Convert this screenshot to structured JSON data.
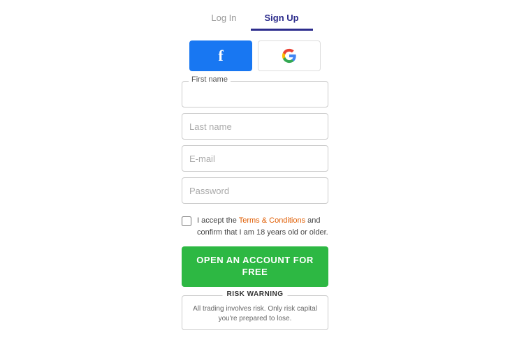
{
  "tabs": {
    "login": {
      "label": "Log In"
    },
    "signup": {
      "label": "Sign Up"
    }
  },
  "social": {
    "facebook_label": "f",
    "google_label": "G"
  },
  "form": {
    "first_name_label": "First name",
    "first_name_placeholder": "",
    "last_name_placeholder": "Last name",
    "email_placeholder": "E-mail",
    "password_placeholder": "Password"
  },
  "checkbox": {
    "text_before": "I accept the ",
    "terms_label": "Terms & Conditions",
    "text_after": " and confirm that I am 18 years old or older."
  },
  "cta_button": {
    "line1": "OPEN AN ACCOUNT FOR",
    "line2": "FREE"
  },
  "risk_warning": {
    "title": "RISK WARNING",
    "text": "All trading involves risk. Only risk capital you're prepared to lose."
  }
}
